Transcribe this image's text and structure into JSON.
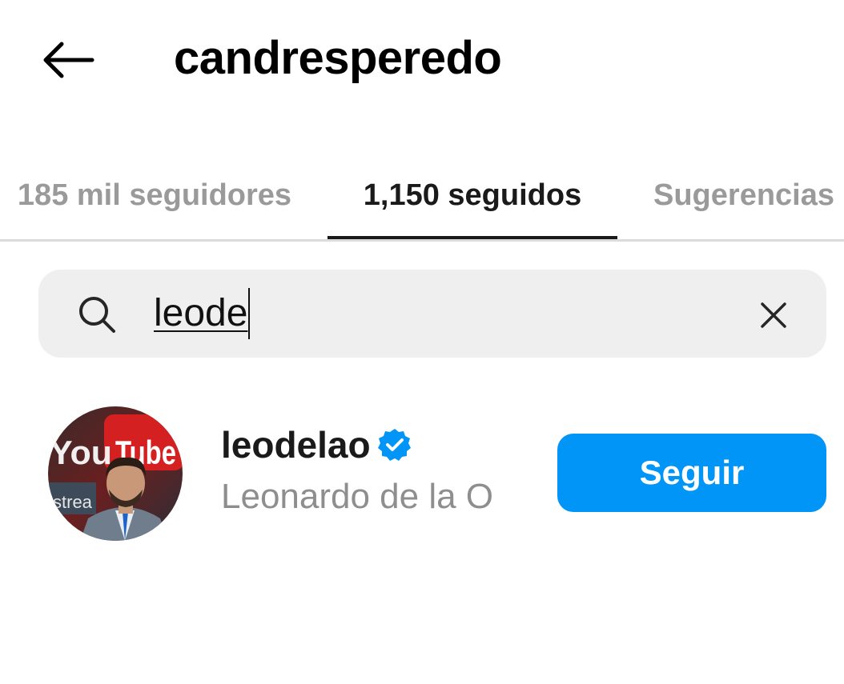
{
  "header": {
    "title": "candresperedo",
    "back_icon": "arrow-left-icon"
  },
  "tabs": [
    {
      "label": "185 mil seguidores",
      "active": false
    },
    {
      "label": "1,150 seguidos",
      "active": true
    },
    {
      "label": "Sugerencias",
      "active": false
    }
  ],
  "search": {
    "icon": "search-icon",
    "value": "leode",
    "clear_icon": "close-icon"
  },
  "results": [
    {
      "username": "leodelao",
      "verified": true,
      "full_name": "Leonardo de la O",
      "avatar_text": [
        "You",
        "Tube",
        "strea"
      ],
      "action_label": "Seguir"
    }
  ],
  "colors": {
    "accent": "#0095f6",
    "verified": "#0095f6",
    "muted_text": "#8e8e8e",
    "search_bg": "#efefef"
  }
}
